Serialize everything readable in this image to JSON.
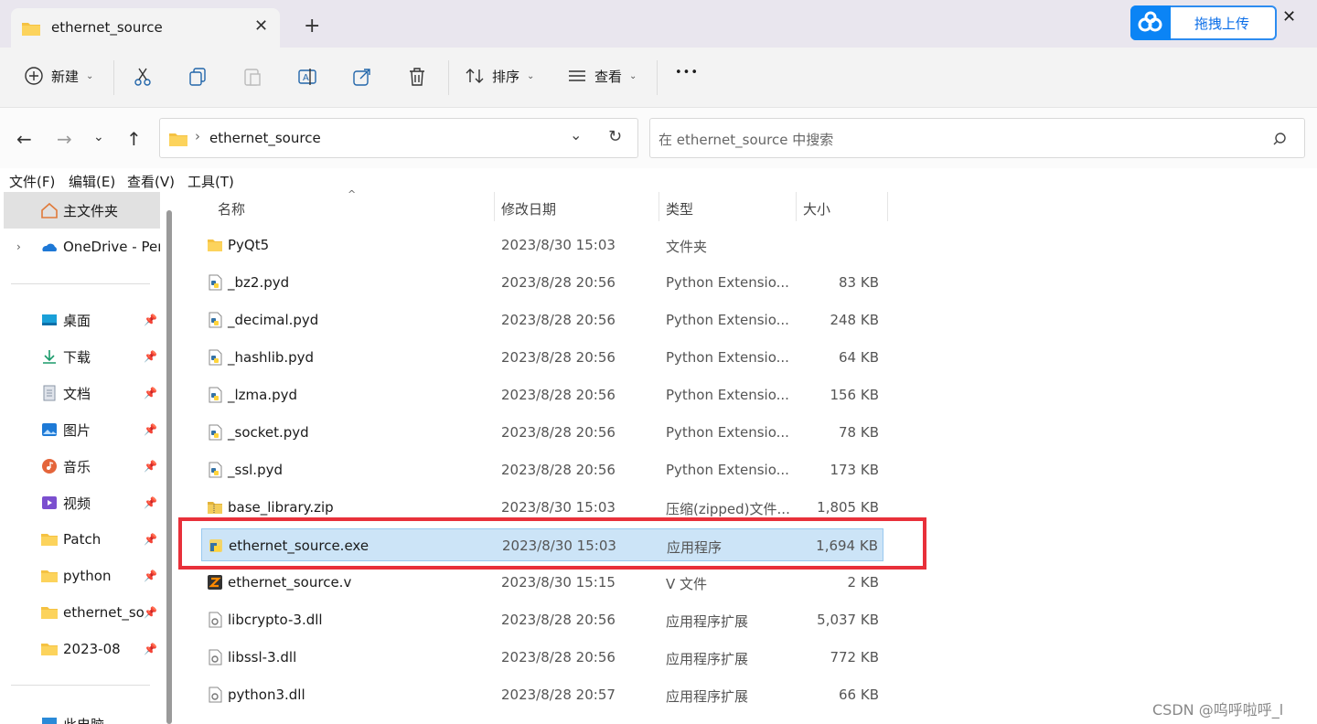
{
  "tab": {
    "title": "ethernet_source"
  },
  "baidu": {
    "label": "拖拽上传"
  },
  "toolbar": {
    "new_label": "新建",
    "sort_label": "排序",
    "view_label": "查看",
    "more": "•••"
  },
  "address": {
    "folder": "ethernet_source",
    "separator": "›"
  },
  "search": {
    "placeholder": "在 ethernet_source 中搜索"
  },
  "menu": {
    "file": "文件(F)",
    "edit": "编辑(E)",
    "view": "查看(V)",
    "tools": "工具(T)"
  },
  "sidebar": {
    "home": "主文件夹",
    "onedrive": "OneDrive - Per",
    "pinned": [
      {
        "label": "桌面",
        "icon": "desktop-icon"
      },
      {
        "label": "下载",
        "icon": "download-icon"
      },
      {
        "label": "文档",
        "icon": "document-icon"
      },
      {
        "label": "图片",
        "icon": "picture-icon"
      },
      {
        "label": "音乐",
        "icon": "music-icon"
      },
      {
        "label": "视频",
        "icon": "video-icon"
      },
      {
        "label": "Patch",
        "icon": "folder-icon"
      },
      {
        "label": "python",
        "icon": "folder-icon"
      },
      {
        "label": "ethernet_so",
        "icon": "folder-icon"
      },
      {
        "label": "2023-08",
        "icon": "folder-icon"
      }
    ],
    "thispc": "此电脑"
  },
  "columns": {
    "name": "名称",
    "date": "修改日期",
    "type": "类型",
    "size": "大小"
  },
  "files": [
    {
      "name": "PyQt5",
      "date": "2023/8/30 15:03",
      "type": "文件夹",
      "size": "",
      "icon": "folder"
    },
    {
      "name": "_bz2.pyd",
      "date": "2023/8/28 20:56",
      "type": "Python Extensio...",
      "size": "83 KB",
      "icon": "pyd"
    },
    {
      "name": "_decimal.pyd",
      "date": "2023/8/28 20:56",
      "type": "Python Extensio...",
      "size": "248 KB",
      "icon": "pyd"
    },
    {
      "name": "_hashlib.pyd",
      "date": "2023/8/28 20:56",
      "type": "Python Extensio...",
      "size": "64 KB",
      "icon": "pyd"
    },
    {
      "name": "_lzma.pyd",
      "date": "2023/8/28 20:56",
      "type": "Python Extensio...",
      "size": "156 KB",
      "icon": "pyd"
    },
    {
      "name": "_socket.pyd",
      "date": "2023/8/28 20:56",
      "type": "Python Extensio...",
      "size": "78 KB",
      "icon": "pyd"
    },
    {
      "name": "_ssl.pyd",
      "date": "2023/8/28 20:56",
      "type": "Python Extensio...",
      "size": "173 KB",
      "icon": "pyd"
    },
    {
      "name": "base_library.zip",
      "date": "2023/8/30 15:03",
      "type": "压缩(zipped)文件...",
      "size": "1,805 KB",
      "icon": "zip"
    },
    {
      "name": "ethernet_source.exe",
      "date": "2023/8/30 15:03",
      "type": "应用程序",
      "size": "1,694 KB",
      "icon": "exe",
      "selected": true
    },
    {
      "name": "ethernet_source.v",
      "date": "2023/8/30 15:15",
      "type": "V 文件",
      "size": "2 KB",
      "icon": "v"
    },
    {
      "name": "libcrypto-3.dll",
      "date": "2023/8/28 20:56",
      "type": "应用程序扩展",
      "size": "5,037 KB",
      "icon": "dll"
    },
    {
      "name": "libssl-3.dll",
      "date": "2023/8/28 20:56",
      "type": "应用程序扩展",
      "size": "772 KB",
      "icon": "dll"
    },
    {
      "name": "python3.dll",
      "date": "2023/8/28 20:57",
      "type": "应用程序扩展",
      "size": "66 KB",
      "icon": "dll"
    }
  ],
  "watermark": "CSDN @呜呼啦呼_l",
  "colors": {
    "selection": "#cce4f7",
    "highlight_box": "#e8303a",
    "folder": "#f5c242"
  }
}
